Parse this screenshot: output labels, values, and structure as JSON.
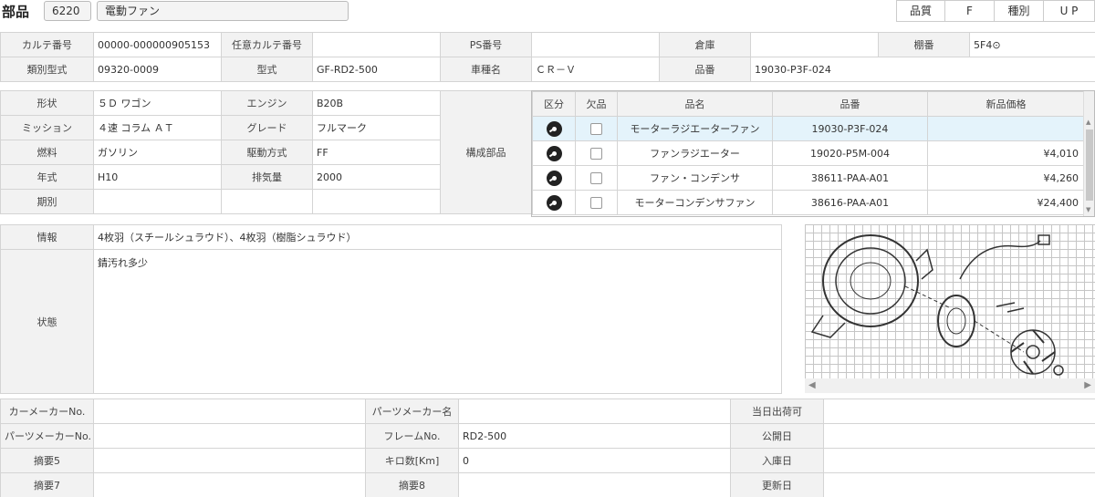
{
  "header": {
    "title": "部品",
    "code": "6220",
    "name": "電動ファン",
    "quality_label": "品質",
    "quality_value": "F",
    "type_label": "種別",
    "type_value": "U P"
  },
  "top_table": {
    "row1": {
      "karte_label": "カルテ番号",
      "karte_value": "00000-000000905153",
      "optional_label": "任意カルテ番号",
      "optional_value": "",
      "ps_label": "PS番号",
      "ps_value": "",
      "warehouse_label": "倉庫",
      "warehouse_value": "",
      "shelf_label": "棚番",
      "shelf_value": "5F4⊙"
    },
    "row2": {
      "class_label": "類別型式",
      "class_value": "09320-0009",
      "model_label": "型式",
      "model_value": "GF-RD2-500",
      "car_label": "車種名",
      "car_value": "ＣＲ－Ｖ",
      "part_no_label": "品番",
      "part_no_value": "19030-P3F-024"
    }
  },
  "spec": {
    "shape_label": "形状",
    "shape_value": "５Ｄ ワゴン",
    "engine_label": "エンジン",
    "engine_value": "B20B",
    "mission_label": "ミッション",
    "mission_value": "４速 コラム ＡＴ",
    "grade_label": "グレード",
    "grade_value": "フルマーク",
    "fuel_label": "燃料",
    "fuel_value": "ガソリン",
    "drive_label": "駆動方式",
    "drive_value": "FF",
    "year_label": "年式",
    "year_value": "H10",
    "displacement_label": "排気量",
    "displacement_value": "2000",
    "period_label": "期別",
    "period_value": "",
    "components_label": "構成部品"
  },
  "components": {
    "headers": {
      "kubun": "区分",
      "kepin": "欠品",
      "name": "品名",
      "part_no": "品番",
      "price": "新品価格"
    },
    "rows": [
      {
        "name": "モーターラジエーターファン",
        "part_no": "19030-P3F-024",
        "price": ""
      },
      {
        "name": "ファンラジエーター",
        "part_no": "19020-P5M-004",
        "price": "¥4,010"
      },
      {
        "name": "ファン・コンデンサ",
        "part_no": "38611-PAA-A01",
        "price": "¥4,260"
      },
      {
        "name": "モーターコンデンサファン",
        "part_no": "38616-PAA-A01",
        "price": "¥24,400"
      }
    ]
  },
  "info": {
    "info_label": "情報",
    "info_value": "4枚羽（スチールシュラウド）、4枚羽（樹脂シュラウド）",
    "condition_label": "状態",
    "condition_value": "錆汚れ多少"
  },
  "bottom": {
    "car_maker_label": "カーメーカーNo.",
    "car_maker_value": "",
    "parts_maker_name_label": "パーツメーカー名",
    "parts_maker_name_value": "",
    "same_day_label": "当日出荷可",
    "parts_maker_no_label": "パーツメーカーNo.",
    "parts_maker_no_value": "",
    "frame_label": "フレームNo.",
    "frame_value": "RD2-500",
    "public_date_label": "公開日",
    "summary5_label": "摘要5",
    "summary5_value": "",
    "km_label": "キロ数[Km]",
    "km_value": "0",
    "stock_date_label": "入庫日",
    "summary7_label": "摘要7",
    "summary7_value": "",
    "summary8_label": "摘要8",
    "summary8_value": "",
    "update_date_label": "更新日"
  }
}
